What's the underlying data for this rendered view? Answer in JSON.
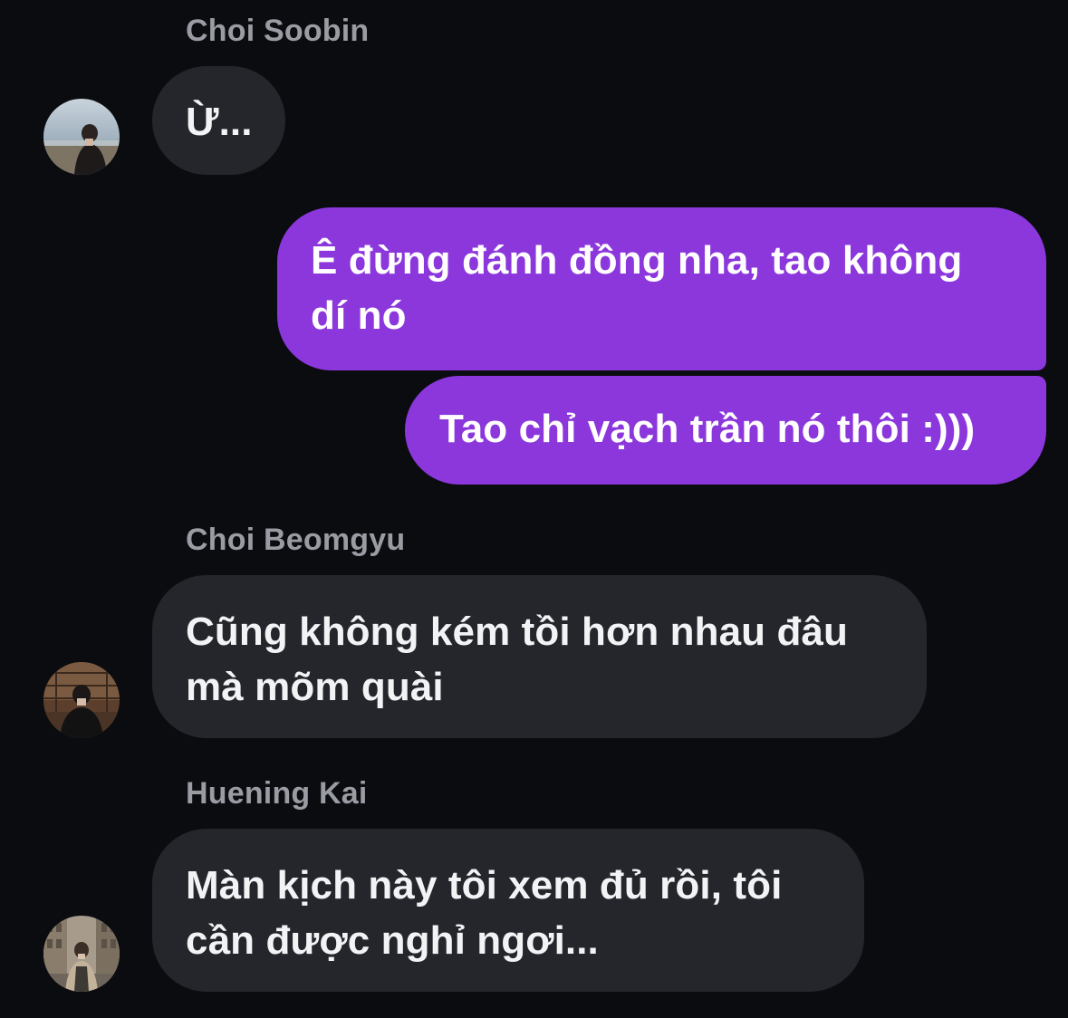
{
  "colors": {
    "background": "#0b0c10",
    "incoming_bubble": "#24262b",
    "outgoing_bubble": "#8b37dc",
    "sender_name": "#9a9ca3",
    "message_text": "#f2f3f5"
  },
  "messages": [
    {
      "sender": "Choi Soobin",
      "direction": "incoming",
      "avatar_icon": "profile-photo-icon",
      "lines": [
        "Ừ..."
      ]
    },
    {
      "sender": "",
      "direction": "outgoing",
      "lines": [
        "Ê đừng đánh đồng nha, tao không",
        "dí nó"
      ]
    },
    {
      "sender": "",
      "direction": "outgoing",
      "lines": [
        "Tao chỉ vạch trần nó thôi :)))"
      ]
    },
    {
      "sender": "Choi Beomgyu",
      "direction": "incoming",
      "avatar_icon": "profile-photo-icon",
      "lines": [
        "Cũng không kém tồi hơn nhau đâu",
        "mà mõm quài"
      ]
    },
    {
      "sender": "Huening Kai",
      "direction": "incoming",
      "avatar_icon": "profile-photo-icon",
      "lines": [
        "Màn kịch này tôi xem đủ rồi, tôi",
        "cần được nghỉ ngơi..."
      ]
    }
  ]
}
